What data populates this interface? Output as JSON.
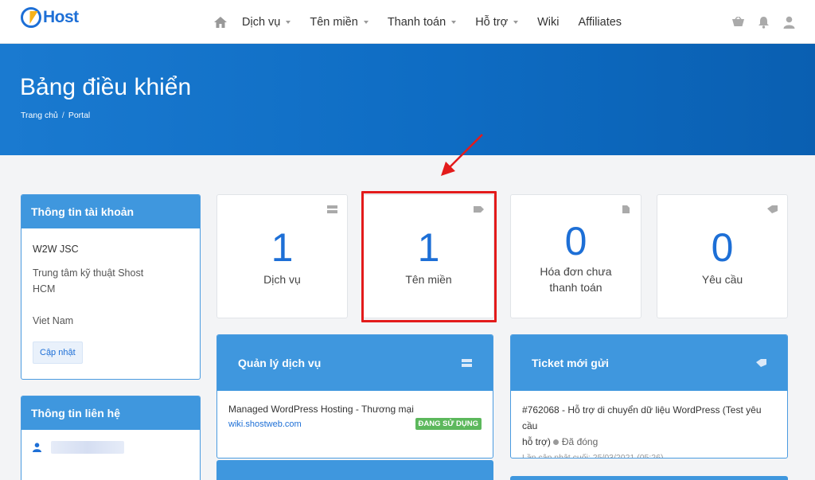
{
  "brand": {
    "logo_text": "Host"
  },
  "nav": {
    "items": [
      {
        "label": "Dịch vụ",
        "dropdown": true
      },
      {
        "label": "Tên miền",
        "dropdown": true
      },
      {
        "label": "Thanh toán",
        "dropdown": true
      },
      {
        "label": "Hỗ trợ",
        "dropdown": true
      },
      {
        "label": "Wiki",
        "dropdown": false
      },
      {
        "label": "Affiliates",
        "dropdown": false
      }
    ]
  },
  "hero": {
    "title": "Bảng điều khiển",
    "breadcrumb": [
      "Trang chủ",
      "Portal"
    ]
  },
  "account_panel": {
    "title": "Thông tin tài khoản",
    "company": "W2W JSC",
    "address_line1": "Trung tâm kỹ thuật Shost",
    "address_line2": "HCM",
    "country": "Viet Nam",
    "update_button": "Cập nhật"
  },
  "contact_panel": {
    "title": "Thông tin liên hệ"
  },
  "stats": [
    {
      "value": "1",
      "label": "Dịch vụ",
      "icon": "server-icon"
    },
    {
      "value": "1",
      "label": "Tên miền",
      "icon": "tag-icon"
    },
    {
      "value": "0",
      "label_line1": "Hóa đơn chưa",
      "label_line2": "thanh toán",
      "icon": "file-icon"
    },
    {
      "value": "0",
      "label": "Yêu cầu",
      "icon": "ticket-icon"
    }
  ],
  "services_panel": {
    "title": "Quản lý dịch vụ",
    "item_name": "Managed WordPress Hosting - Thương mại",
    "item_domain": "wiki.shostweb.com",
    "item_status": "ĐANG SỬ DỤNG"
  },
  "tickets_panel": {
    "title": "Ticket mới gửi",
    "ticket_line1": "#762068 - Hỗ trợ di chuyển dữ liệu WordPress (Test yêu cầu",
    "ticket_line2": "hỗ trợ)",
    "ticket_status": "Đã đóng",
    "ticket_updated": "Lần cập nhật cuối: 25/03/2021 (05:26)"
  },
  "colors": {
    "primary": "#1d6fd6",
    "panel_header": "#3f97de",
    "highlight": "#e31b1b",
    "badge": "#5cb85c"
  }
}
